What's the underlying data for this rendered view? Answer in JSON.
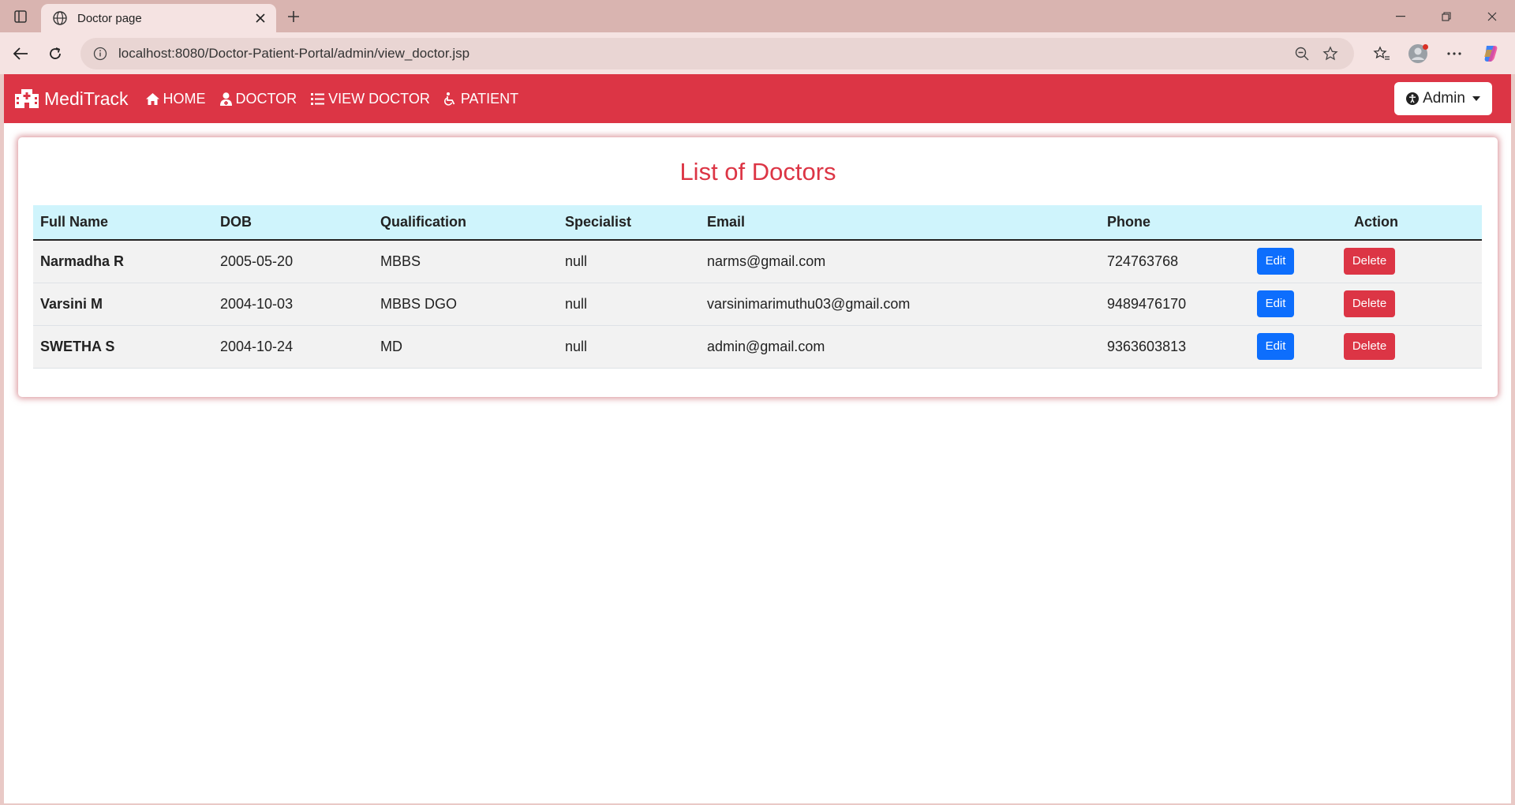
{
  "browser": {
    "tab_title": "Doctor page",
    "url": "localhost:8080/Doctor-Patient-Portal/admin/view_doctor.jsp"
  },
  "navbar": {
    "brand": "MediTrack",
    "links": [
      {
        "label": "HOME",
        "icon": "home-icon"
      },
      {
        "label": "DOCTOR",
        "icon": "user-doctor-icon"
      },
      {
        "label": "VIEW DOCTOR",
        "icon": "list-icon"
      },
      {
        "label": "PATIENT",
        "icon": "wheelchair-icon"
      }
    ],
    "admin_label": "Admin",
    "accent_color": "#dc3545"
  },
  "main": {
    "title": "List of Doctors",
    "columns": [
      "Full Name",
      "DOB",
      "Qualification",
      "Specialist",
      "Email",
      "Phone",
      "Action"
    ],
    "rows": [
      {
        "name": "Narmadha R",
        "dob": "2005-05-20",
        "qualification": "MBBS",
        "specialist": "null",
        "email": "narms@gmail.com",
        "phone": "724763768"
      },
      {
        "name": "Varsini M",
        "dob": "2004-10-03",
        "qualification": "MBBS DGO",
        "specialist": "null",
        "email": "varsinimarimuthu03@gmail.com",
        "phone": "9489476170"
      },
      {
        "name": "SWETHA S",
        "dob": "2004-10-24",
        "qualification": "MD",
        "specialist": "null",
        "email": "admin@gmail.com",
        "phone": "9363603813"
      }
    ],
    "edit_label": "Edit",
    "delete_label": "Delete"
  }
}
